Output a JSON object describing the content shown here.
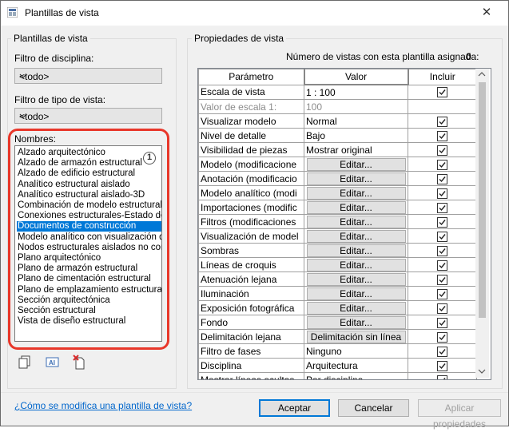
{
  "window": {
    "title": "Plantillas de vista",
    "close_glyph": "✕"
  },
  "left": {
    "group_label": "Plantillas de vista",
    "discipline_label": "Filtro de disciplina:",
    "discipline_value": "<todo>",
    "viewtype_label": "Filtro de tipo de vista:",
    "viewtype_value": "<todo>",
    "names_label": "Nombres:",
    "callout_number": "1",
    "names": [
      "Alzado arquitectónico",
      "Alzado de armazón estructural",
      "Alzado de edificio estructural",
      "Analítico estructural aislado",
      "Analítico estructural aislado-3D",
      "Combinación de modelo estructural y",
      "Conexiones estructurales-Estado de a",
      "Documentos de construcción",
      "Modelo analítico con visualización del s",
      "Nodos estructurales aislados no cone",
      "Plano arquitectónico",
      "Plano de armazón estructural",
      "Plano de cimentación estructural",
      "Plano de emplazamiento estructural",
      "Sección arquitectónica",
      "Sección estructural",
      "Vista de diseño estructural"
    ],
    "selected_index": 7,
    "tool_icons": [
      "duplicate-icon",
      "rename-icon",
      "delete-icon"
    ]
  },
  "right": {
    "group_label": "Propiedades de vista",
    "count_label": "Número de vistas con esta plantilla asignada:",
    "count_value": "0",
    "columns": [
      "Parámetro",
      "Valor",
      "Incluir"
    ],
    "rows": [
      {
        "param": "Escala de vista",
        "value": "1 : 100",
        "kind": "text",
        "include": true
      },
      {
        "param": "Valor de escala    1:",
        "value": "100",
        "kind": "gray",
        "include": null
      },
      {
        "param": "Visualizar modelo",
        "value": "Normal",
        "kind": "text",
        "include": true
      },
      {
        "param": "Nivel de detalle",
        "value": "Bajo",
        "kind": "text",
        "include": true
      },
      {
        "param": "Visibilidad de piezas",
        "value": "Mostrar original",
        "kind": "text",
        "include": true
      },
      {
        "param": "Modelo (modificacione",
        "value": "Editar...",
        "kind": "button",
        "include": true
      },
      {
        "param": "Anotación (modificacio",
        "value": "Editar...",
        "kind": "button",
        "include": true
      },
      {
        "param": "Modelo analítico (modi",
        "value": "Editar...",
        "kind": "button",
        "include": true
      },
      {
        "param": "Importaciones (modific",
        "value": "Editar...",
        "kind": "button",
        "include": true
      },
      {
        "param": "Filtros (modificaciones",
        "value": "Editar...",
        "kind": "button",
        "include": true
      },
      {
        "param": "Visualización de model",
        "value": "Editar...",
        "kind": "button",
        "include": true
      },
      {
        "param": "Sombras",
        "value": "Editar...",
        "kind": "button",
        "include": true
      },
      {
        "param": "Líneas de croquis",
        "value": "Editar...",
        "kind": "button",
        "include": true
      },
      {
        "param": "Atenuación lejana",
        "value": "Editar...",
        "kind": "button",
        "include": true
      },
      {
        "param": "Iluminación",
        "value": "Editar...",
        "kind": "button",
        "include": true
      },
      {
        "param": "Exposición fotográfica",
        "value": "Editar...",
        "kind": "button",
        "include": true
      },
      {
        "param": "Fondo",
        "value": "Editar...",
        "kind": "button",
        "include": true
      },
      {
        "param": "Delimitación lejana",
        "value": "Delimitación sin línea",
        "kind": "button",
        "include": true
      },
      {
        "param": "Filtro de fases",
        "value": "Ninguno",
        "kind": "text",
        "include": true
      },
      {
        "param": "Disciplina",
        "value": "Arquitectura",
        "kind": "text",
        "include": true
      },
      {
        "param": "Mostrar líneas ocultas",
        "value": "Por disciplina",
        "kind": "text",
        "include": true
      }
    ]
  },
  "footer": {
    "help_link": "¿Cómo se modifica una plantilla de vista?",
    "accept": "Aceptar",
    "cancel": "Cancelar",
    "apply": "Aplicar propiedades"
  },
  "colors": {
    "accent": "#0078d7",
    "callout": "#e8372a",
    "link": "#0066cc"
  }
}
